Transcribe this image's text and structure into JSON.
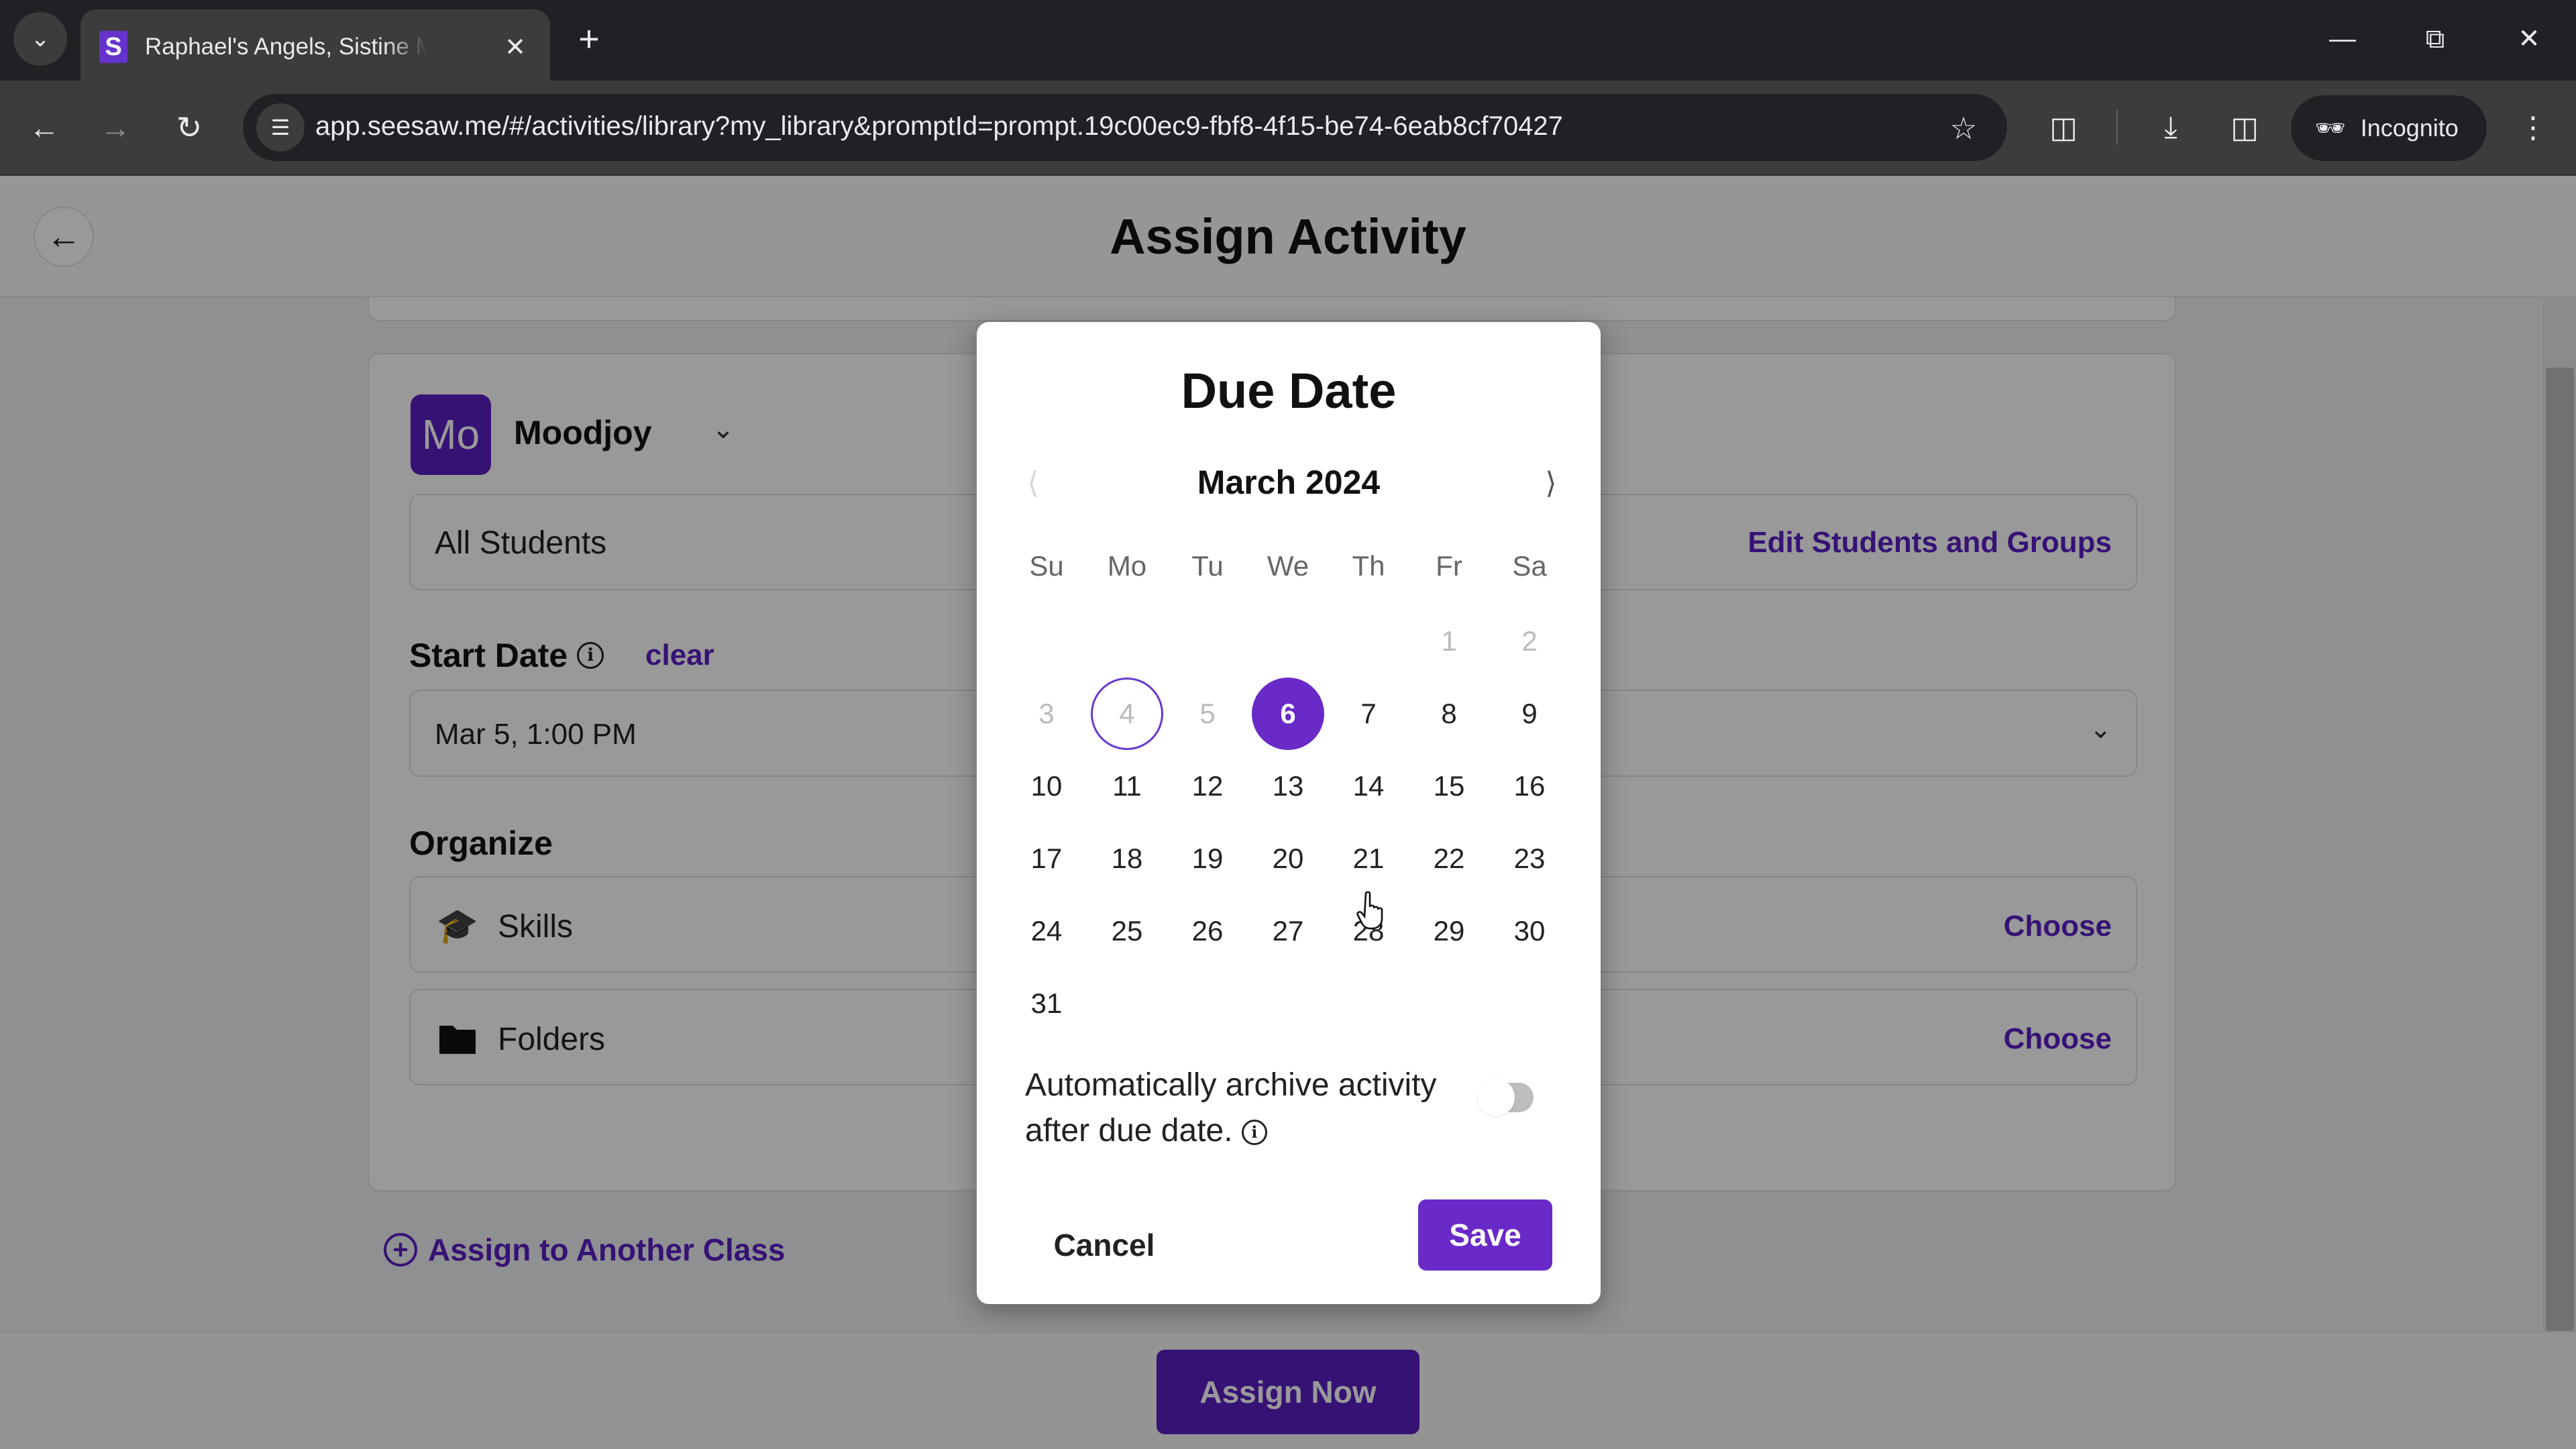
{
  "browser": {
    "tab_title": "Raphael's Angels, Sistine Madonna",
    "url": "app.seesaw.me/#/activities/library?my_library&promptId=prompt.19c00ec9-fbf8-4f15-be74-6eab8cf70427",
    "profile_label": "Incognito",
    "favicon_letter": "S"
  },
  "header": {
    "title": "Assign Activity"
  },
  "class_card": {
    "avatar_initials": "Mo",
    "class_name": "Moodjoy",
    "students_label": "All Students",
    "edit_students_label": "Edit Students and Groups",
    "start_date_label": "Start Date",
    "clear_label": "clear",
    "start_date_value": "Mar 5, 1:00 PM",
    "organize_label": "Organize",
    "organize_items": [
      {
        "label": "Skills",
        "icon": "graduation-cap-icon",
        "action": "Choose"
      },
      {
        "label": "Folders",
        "icon": "folder-icon",
        "action": "Choose"
      }
    ]
  },
  "assign_another_label": "Assign to Another Class",
  "assign_now_label": "Assign Now",
  "dialog": {
    "title": "Due Date",
    "month_label": "March 2024",
    "weekdays": [
      "Su",
      "Mo",
      "Tu",
      "We",
      "Th",
      "Fr",
      "Sa"
    ],
    "leading_blanks": 5,
    "days_in_month": 31,
    "disabled_through": 5,
    "today": 4,
    "selected": 6,
    "archive_label": "Automatically archive activity after due date.",
    "archive_enabled": false,
    "cancel_label": "Cancel",
    "save_label": "Save"
  },
  "colors": {
    "brand_purple": "#6a2ac8"
  }
}
